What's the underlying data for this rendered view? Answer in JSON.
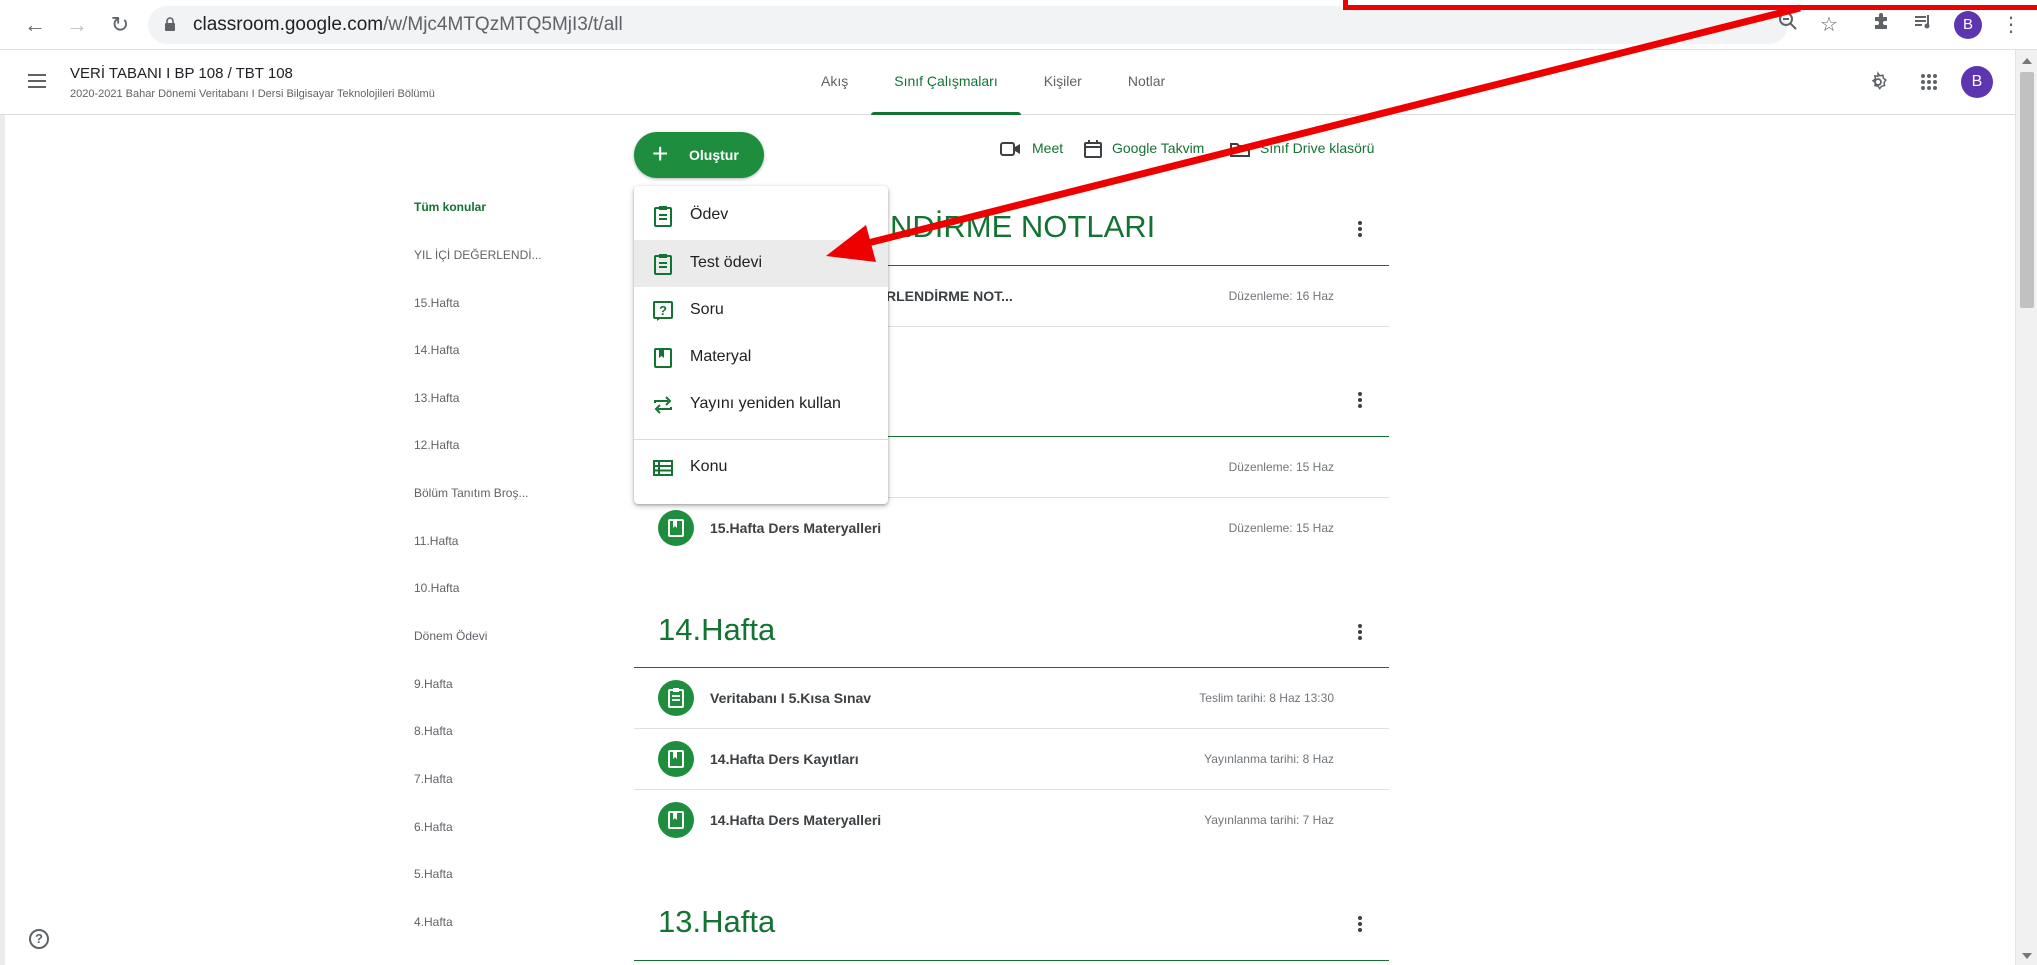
{
  "browser": {
    "url_host": "classroom.google.com",
    "url_path": "/w/Mjc4MTQzMTQ5MjI3/t/all",
    "profile_initial": "B"
  },
  "header": {
    "title": "VERİ TABANI I BP 108 / TBT 108",
    "subtitle": "2020-2021 Bahar Dönemi Veritabanı I Dersi Bilgisayar Teknolojileri Bölümü",
    "tabs": [
      "Akış",
      "Sınıf Çalışmaları",
      "Kişiler",
      "Notlar"
    ],
    "active_tab": "Sınıf Çalışmaları",
    "avatar_initial": "B"
  },
  "toolbar": {
    "create_label": "Oluştur",
    "meet_label": "Meet",
    "calendar_label": "Google Takvim",
    "drive_label": "Sınıf Drive klasörü"
  },
  "topics": [
    "Tüm konular",
    "YIL İÇİ DEĞERLENDİ...",
    "15.Hafta",
    "14.Hafta",
    "13.Hafta",
    "12.Hafta",
    "Bölüm Tanıtım Broş...",
    "11.Hafta",
    "10.Hafta",
    "Dönem Ödevi",
    "9.Hafta",
    "8.Hafta",
    "7.Hafta",
    "6.Hafta",
    "5.Hafta",
    "4.Hafta"
  ],
  "menu": {
    "items": [
      "Ödev",
      "Test ödevi",
      "Soru",
      "Materyal",
      "Yayını yeniden kullan",
      "Konu"
    ],
    "highlighted": "Test ödevi"
  },
  "sections": [
    {
      "title_visible": "NDİRME NOTLARI",
      "items": [
        {
          "title_visible": "RLENDİRME NOT...",
          "meta": "Düzenleme: 16 Haz"
        }
      ]
    },
    {
      "title_visible": "",
      "items": [
        {
          "title_visible": "",
          "meta": "Düzenleme: 15 Haz"
        },
        {
          "title": "15.Hafta Ders Materyalleri",
          "meta": "Düzenleme: 15 Haz"
        }
      ]
    },
    {
      "title": "14.Hafta",
      "items": [
        {
          "title": "Veritabanı I 5.Kısa Sınav",
          "meta": "Teslim tarihi: 8 Haz 13:30"
        },
        {
          "title": "14.Hafta Ders Kayıtları",
          "meta": "Yayınlanma tarihi: 8 Haz"
        },
        {
          "title": "14.Hafta Ders Materyalleri",
          "meta": "Yayınlanma tarihi: 7 Haz"
        }
      ]
    },
    {
      "title": "13.Hafta",
      "items": []
    }
  ],
  "colors": {
    "accent": "#137333",
    "button": "#1e8e3e",
    "avatar": "#5e35b1",
    "annotation": "#ee0000"
  }
}
